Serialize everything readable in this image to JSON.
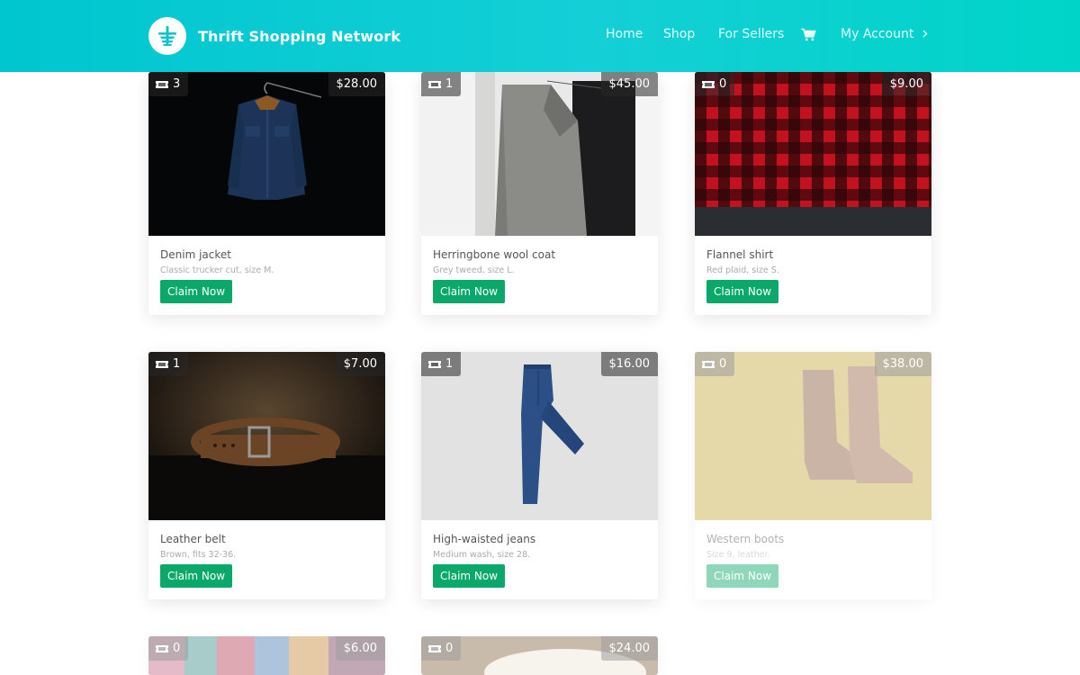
{
  "brand": {
    "name": "Thrift Shopping Network",
    "logo_icon": "shopping-basket-icon"
  },
  "nav": {
    "home": "Home",
    "shop": "Shop",
    "sellers": "For Sellers",
    "cart_icon": "cart-icon",
    "account": "My Account"
  },
  "colors": {
    "header_start": "#00c6cf",
    "header_end": "#00d4c8",
    "claim_button": "#0aa86a"
  },
  "products": [
    {
      "title": "Denim jacket",
      "desc": "Classic trucker cut, size M.",
      "price": "$28.00",
      "count": "3",
      "claim": "Claim Now",
      "available": true
    },
    {
      "title": "Herringbone wool coat",
      "desc": "Grey tweed, size L.",
      "price": "$45.00",
      "count": "1",
      "claim": "Claim Now",
      "available": true
    },
    {
      "title": "Flannel shirt",
      "desc": "Red plaid, size S.",
      "price": "$9.00",
      "count": "0",
      "claim": "Claim Now",
      "available": true
    },
    {
      "title": "Leather belt",
      "desc": "Brown, fits 32-36.",
      "price": "$7.00",
      "count": "1",
      "claim": "Claim Now",
      "available": true
    },
    {
      "title": "High-waisted jeans",
      "desc": "Medium wash, size 28.",
      "price": "$16.00",
      "count": "1",
      "claim": "Claim Now",
      "available": true
    },
    {
      "title": "Western boots",
      "desc": "Size 9, leather.",
      "price": "$38.00",
      "count": "0",
      "claim": "Claim Now",
      "available": false
    },
    {
      "price": "$6.00",
      "count": "0",
      "available": false
    },
    {
      "price": "$24.00",
      "count": "0",
      "available": false
    }
  ]
}
